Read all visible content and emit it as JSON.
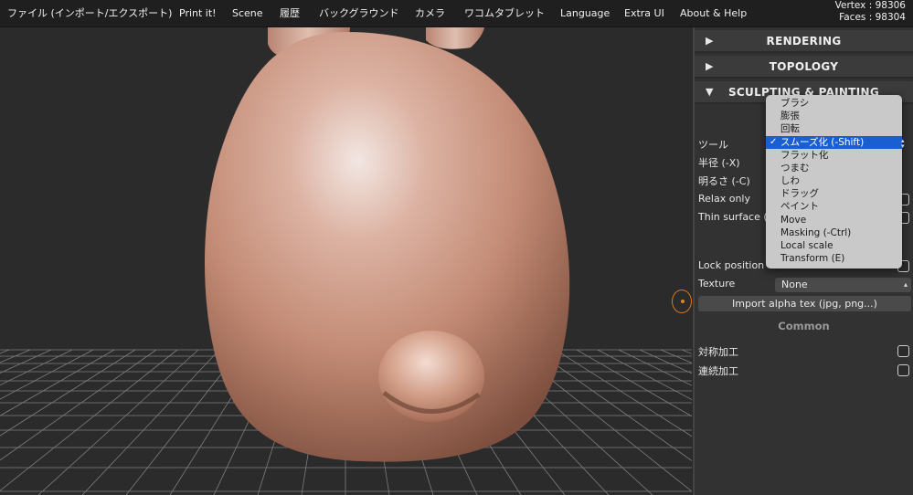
{
  "menu": {
    "items": [
      {
        "label": "ファイル (インポート/エクスポート)"
      },
      {
        "label": "Print it!"
      },
      {
        "label": "Scene"
      },
      {
        "label": "履歴"
      },
      {
        "label": "バックグラウンド"
      },
      {
        "label": "カメラ"
      },
      {
        "label": "ワコムタブレット"
      },
      {
        "label": "Language"
      },
      {
        "label": "Extra UI"
      },
      {
        "label": "About & Help"
      }
    ]
  },
  "stats": {
    "vertex": "Vertex : 98306",
    "faces": "Faces : 98304"
  },
  "viewport": {
    "cursor_icon": "brush-cursor-icon"
  },
  "panel": {
    "sections": {
      "rendering": {
        "label": "RENDERING",
        "arrow": "▶"
      },
      "topology": {
        "label": "TOPOLOGY",
        "arrow": "▶"
      },
      "sculpting": {
        "label": "SCULPTING & PAINTING",
        "arrow": "▼"
      }
    },
    "tool_label": "ツール",
    "radius_label": "半径 (-X)",
    "intensity_label": "明るさ (-C)",
    "relax_only_label": "Relax only",
    "thin_surface_label": "Thin surface (front vertex only)",
    "lock_position_label": "Lock position",
    "texture_label": "Texture",
    "texture_value": "None",
    "import_button": "Import alpha tex (jpg, png...)",
    "common_heading": "Common",
    "symmetry_label": "対称加工",
    "continuous_label": "連続加工"
  },
  "tool_dropdown": {
    "selected": "スムーズ化 (-Shift)",
    "options": [
      {
        "label": "ブラシ"
      },
      {
        "label": "膨張"
      },
      {
        "label": "回転"
      },
      {
        "label": "スムーズ化 (-Shift)"
      },
      {
        "label": "フラット化"
      },
      {
        "label": "つまむ"
      },
      {
        "label": "しわ"
      },
      {
        "label": "ドラッグ"
      },
      {
        "label": "ペイント"
      },
      {
        "label": "Move"
      },
      {
        "label": "Masking (-Ctrl)"
      },
      {
        "label": "Local scale"
      },
      {
        "label": "Transform (E)"
      }
    ]
  },
  "colors": {
    "selection": "#1a5fd1",
    "brush_cursor": "#d67b1f",
    "model_skin": "#c8927c"
  }
}
